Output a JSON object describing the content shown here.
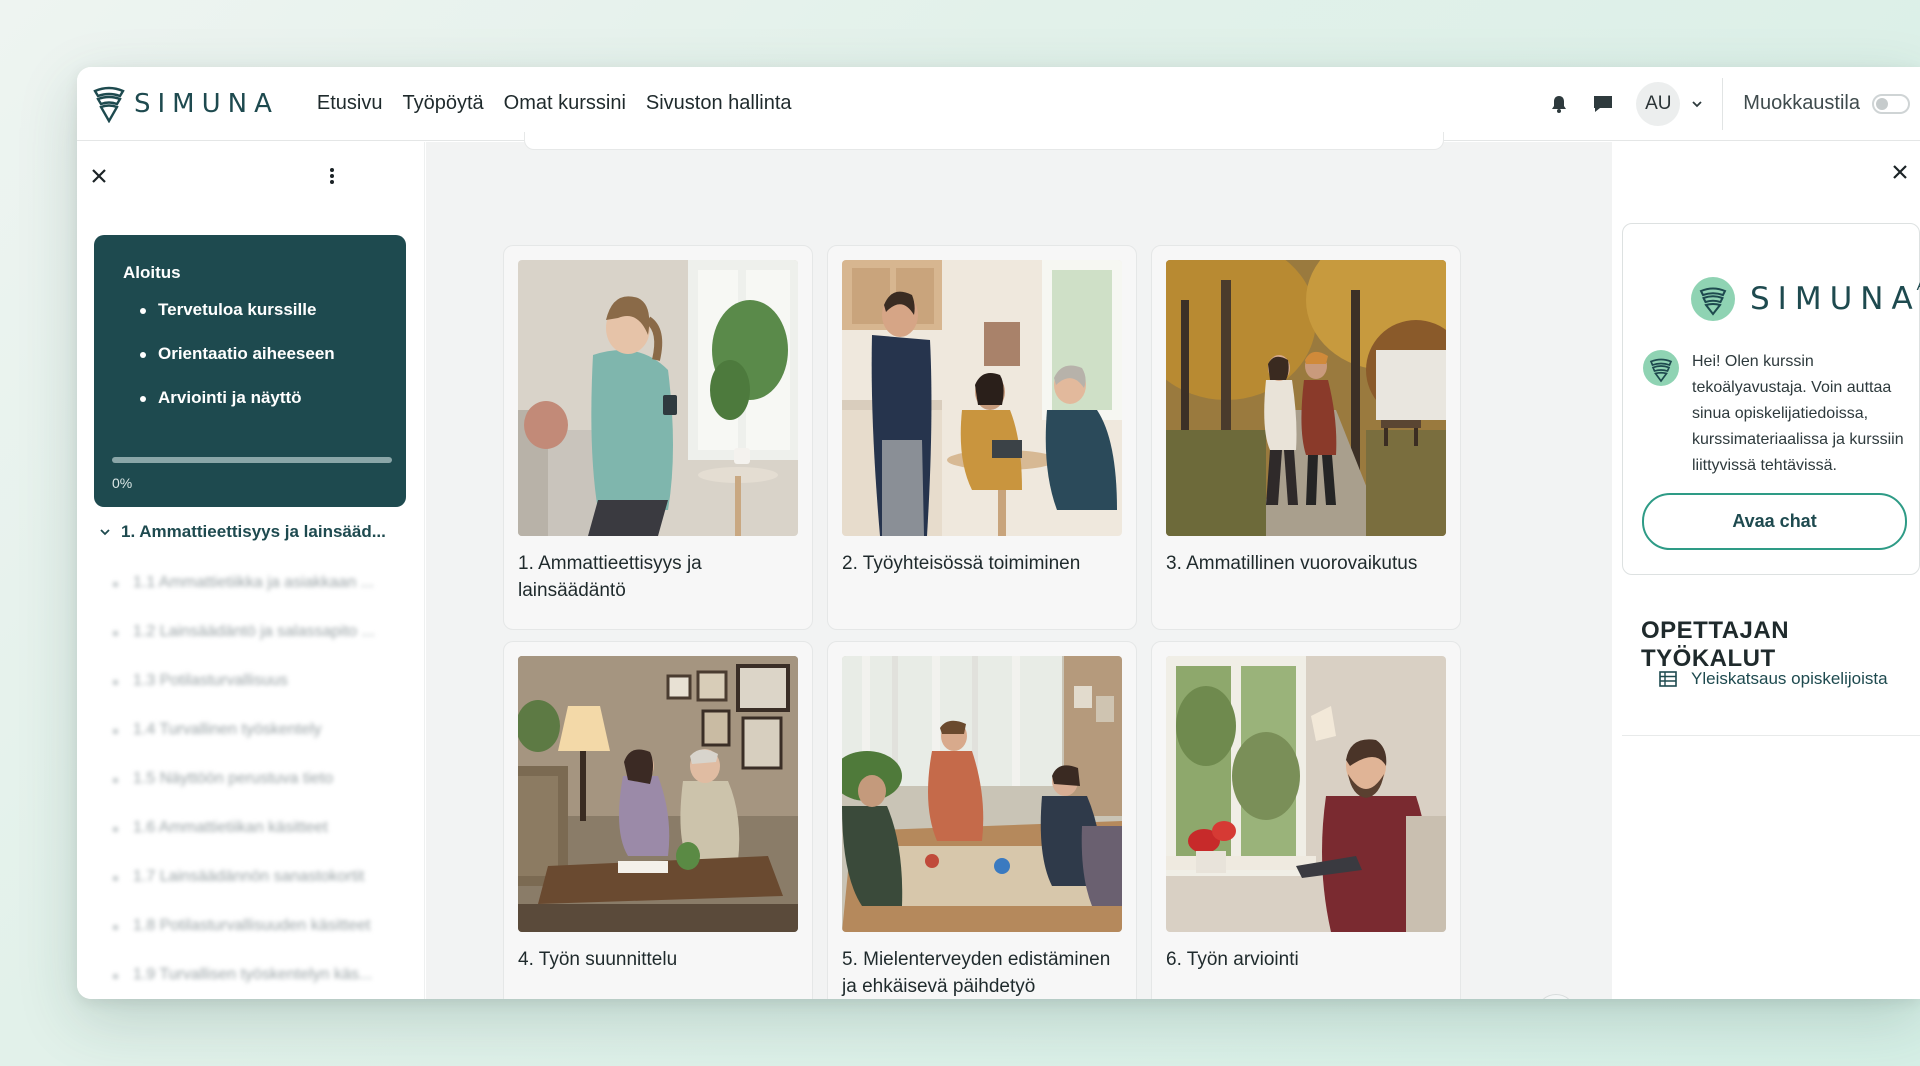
{
  "nav": {
    "brand": "SIMUNA",
    "links": [
      "Etusivu",
      "Työpöytä",
      "Omat kurssini",
      "Sivuston hallinta"
    ],
    "user_initials": "AU",
    "edit_mode_label": "Muokkaustila"
  },
  "sidebar": {
    "section": {
      "title": "Aloitus",
      "items": [
        "Tervetuloa kurssille",
        "Orientaatio aiheeseen",
        "Arviointi ja näyttö"
      ],
      "progress_value": 0,
      "progress_label": "0%"
    },
    "module": {
      "title": "1. Ammattieettisyys ja lainsääd...",
      "items": [
        "1.1 Ammattietiikka ja asiakkaan ...",
        "1.2 Lainsäädäntö ja salassapito ...",
        "1.3 Potilasturvallisuus",
        "1.4 Turvallinen työskentely",
        "1.5 Näyttöön perustuva tieto",
        "1.6 Ammattietiikan käsitteet",
        "1.7 Lainsäädännön sanastokortit",
        "1.8 Potilasturvallisuuden käsitteet",
        "1.9 Turvallisen työskentelyn käs..."
      ]
    }
  },
  "courses": [
    {
      "title": "1. Ammattieettisyys ja lainsäädäntö",
      "image": "woman-with-phone-photo"
    },
    {
      "title": "2. Työyhteisössä toimiminen",
      "image": "kitchen-team-photo"
    },
    {
      "title": "3. Ammatillinen vuorovaikutus",
      "image": "autumn-walk-photo"
    },
    {
      "title": "4. Työn suunnittelu",
      "image": "living-room-planning-photo"
    },
    {
      "title": "5. Mielenterveyden edistäminen ja ehkäisevä päihdetyö",
      "image": "group-workshop-photo"
    },
    {
      "title": "6. Työn arviointi",
      "image": "man-with-tablet-photo"
    }
  ],
  "help_label": "?",
  "ai_panel": {
    "brand": "SIMUNA",
    "brand_sup": "AI",
    "message": "Hei! Olen kurssin tekoälyavustaja. Voin auttaa sinua opiskelijatiedoissa, kurssimateriaalissa ja kurssiin liittyvissä tehtävissä.",
    "open_chat_label": "Avaa chat",
    "tools_title": "OPETTAJAN TYÖKALUT",
    "tools_link": "Yleiskatsaus opiskelijoista"
  },
  "colors": {
    "brand_dark": "#1e4a4f",
    "brand_teal": "#2e9b86",
    "mint": "#8fd3b3"
  }
}
